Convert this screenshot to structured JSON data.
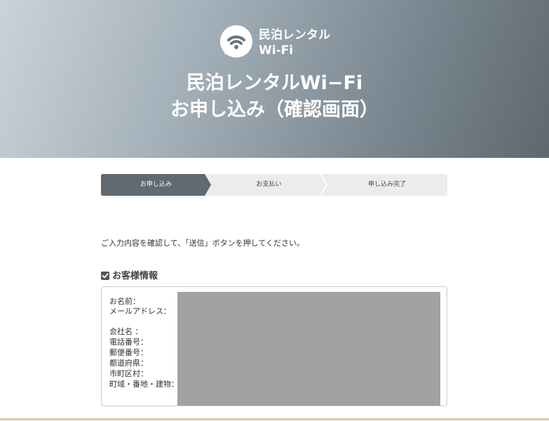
{
  "brand": {
    "logo_line1": "民泊レンタル",
    "logo_line2": "Wi-Fi",
    "logo_icon": "wifi-icon"
  },
  "hero": {
    "title_line1": "民泊レンタルWi−Fi",
    "title_line2": "お申し込み（確認画面）"
  },
  "steps": [
    {
      "label": "お申し込み",
      "active": true
    },
    {
      "label": "お支払い",
      "active": false
    },
    {
      "label": "申し込み完了",
      "active": false
    }
  ],
  "instruction": "ご入力内容を確認して、「送信」ボタンを押してください。",
  "customer_section": {
    "title": "お客様情報",
    "checkbox_icon": "checkbox-checked-icon",
    "fields": {
      "name": "お名前：",
      "email": "メールアドレス：",
      "company": "会社名 ：",
      "phone": "電話番号：",
      "postal": "郵便番号：",
      "prefecture": "都道府県：",
      "city": "市町区村：",
      "address": "町域・番地・建物："
    }
  },
  "colors": {
    "active_step": "#5f6a72",
    "inactive_step": "#ececec",
    "redacted": "#a2a2a2",
    "accent_line": "#d8c79a"
  }
}
